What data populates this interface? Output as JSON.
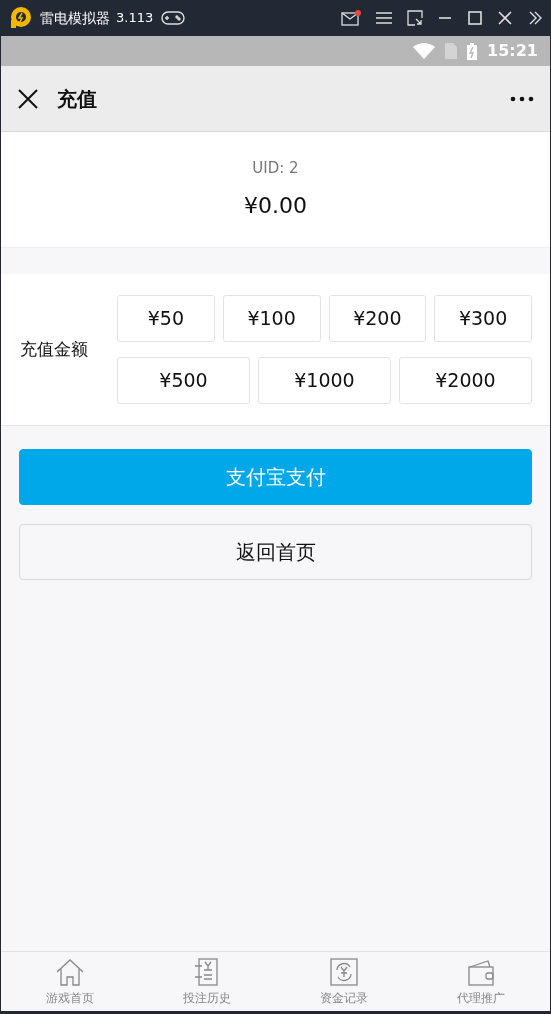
{
  "window": {
    "title": "雷电模拟器",
    "version": "3.113"
  },
  "status_bar": {
    "time": "15:21"
  },
  "header": {
    "title": "充值"
  },
  "account": {
    "uid": "UID: 2",
    "balance": "¥0.00"
  },
  "amount": {
    "label": "充值金额",
    "options": [
      {
        "kind": "quarter",
        "text": "¥50",
        "selected": false
      },
      {
        "kind": "quarter",
        "text": "¥100",
        "selected": false
      },
      {
        "kind": "quarter",
        "text": "¥200",
        "selected": false
      },
      {
        "kind": "quarter",
        "text": "¥300",
        "selected": false
      },
      {
        "kind": "third",
        "text": "¥500",
        "selected": false
      },
      {
        "kind": "third",
        "text": "¥1000",
        "selected": false
      },
      {
        "kind": "third",
        "text": "¥2000",
        "selected": false
      }
    ]
  },
  "buttons": [
    {
      "kind": "primary",
      "label": "支付宝支付"
    },
    {
      "kind": "secondary",
      "label": "返回首页"
    }
  ],
  "tabs": [
    {
      "kind": "home",
      "label": "游戏首页"
    },
    {
      "kind": "history",
      "label": "投注历史"
    },
    {
      "kind": "funds",
      "label": "资金记录"
    },
    {
      "kind": "agent",
      "label": "代理推广"
    }
  ]
}
